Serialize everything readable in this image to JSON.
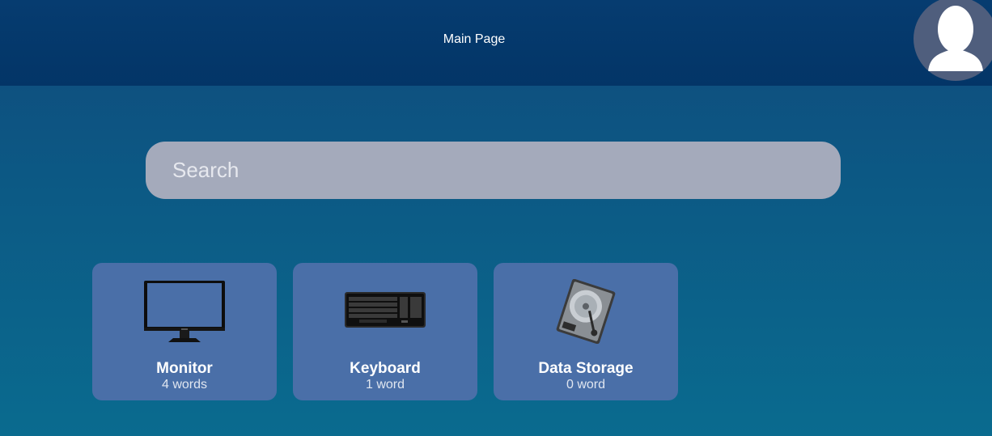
{
  "header": {
    "title": "Main Page",
    "avatar_icon": "user-silhouette-icon"
  },
  "search": {
    "placeholder": "Search",
    "value": ""
  },
  "categories": [
    {
      "title": "Monitor",
      "count": "4 words",
      "icon": "monitor-icon"
    },
    {
      "title": "Keyboard",
      "count": "1 word",
      "icon": "keyboard-icon"
    },
    {
      "title": "Data Storage",
      "count": "0 word",
      "icon": "hard-drive-icon"
    }
  ],
  "colors": {
    "header_bg": "#033567",
    "card_bg": "#4a6fa8",
    "search_bg": "#a4aabb",
    "avatar_bg": "#4f5e7d"
  }
}
